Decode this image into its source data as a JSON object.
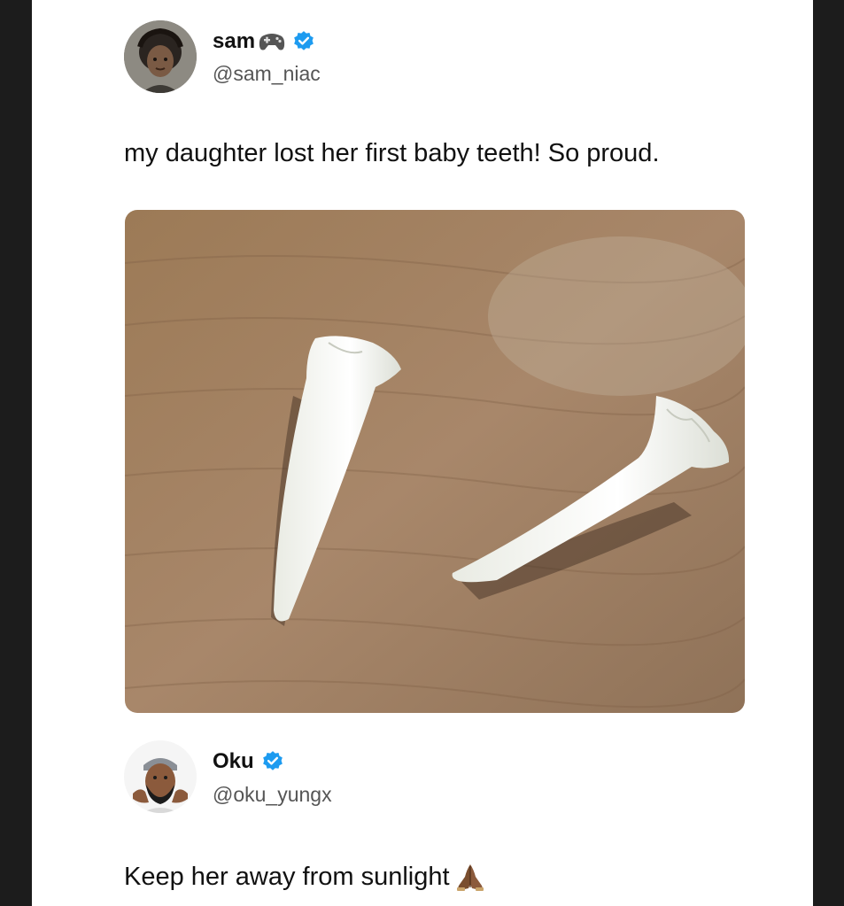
{
  "posts": [
    {
      "display_name": "sam",
      "name_emoji_icon": "game-controller-icon",
      "verified_icon": "verified-badge-icon",
      "handle": "@sam_niac",
      "text": "my daughter lost her first baby teeth! So proud.",
      "media": "photo-two-long-white-teeth-on-wooden-table"
    },
    {
      "display_name": "Oku",
      "verified_icon": "verified-badge-icon",
      "handle": "@oku_yungx",
      "text": "Keep her away from sunlight",
      "text_emoji_icon": "folded-hands-icon"
    }
  ],
  "colors": {
    "verified_blue": "#1d9bf0",
    "background": "#ffffff",
    "outer_border": "#1c1c1c"
  }
}
